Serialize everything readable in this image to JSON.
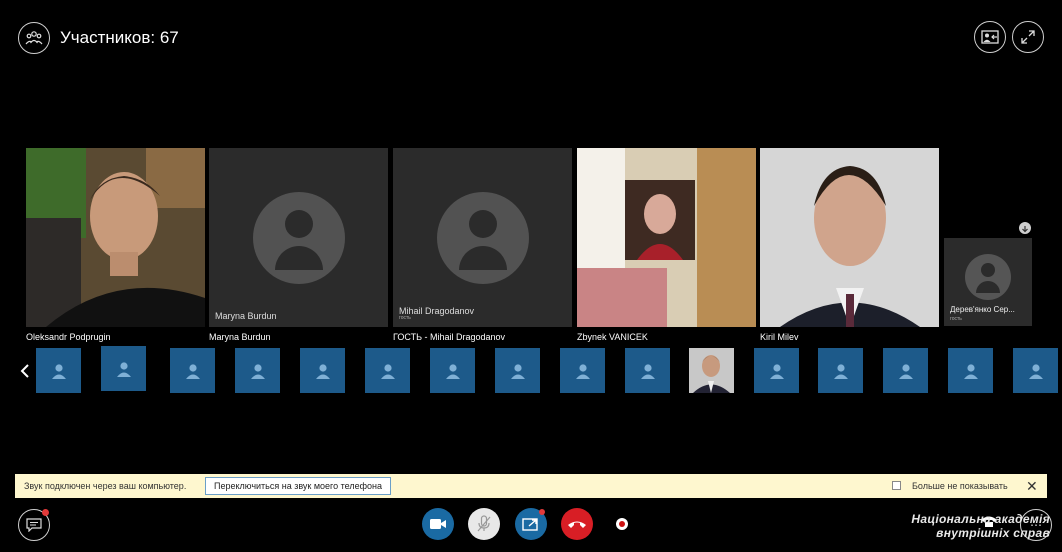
{
  "header": {
    "participants_title": "Участников: 67"
  },
  "gallery": [
    {
      "label": "Oleksandr Podprugin"
    },
    {
      "label": "Maryna Burdun",
      "inner_name": "Maryna Burdun"
    },
    {
      "label": "ГОСТЬ - Mihail Dragodanov",
      "inner_name": "Mihail Dragodanov",
      "inner_sub": "гость"
    },
    {
      "label": "Zbynek VANICEK"
    },
    {
      "label": "Kiril Milev"
    }
  ],
  "overflow_tile": {
    "name": "Дерев'янко Сер...",
    "sub": "гость"
  },
  "notification": {
    "message": "Звук подключен через ваш компьютер.",
    "switch_label": "Переключиться на звук моего телефона",
    "dont_show_label": "Больше не показывать",
    "close_glyph": "✕"
  },
  "watermark": {
    "line1": "Національна академія",
    "line2": "внутрішніх справ"
  },
  "colors": {
    "background": "#000000",
    "strip_tile": "#1d5a8a",
    "video_button": "#1a6aa3",
    "end_call": "#d81e25",
    "notification_bg": "#fef7cf"
  }
}
